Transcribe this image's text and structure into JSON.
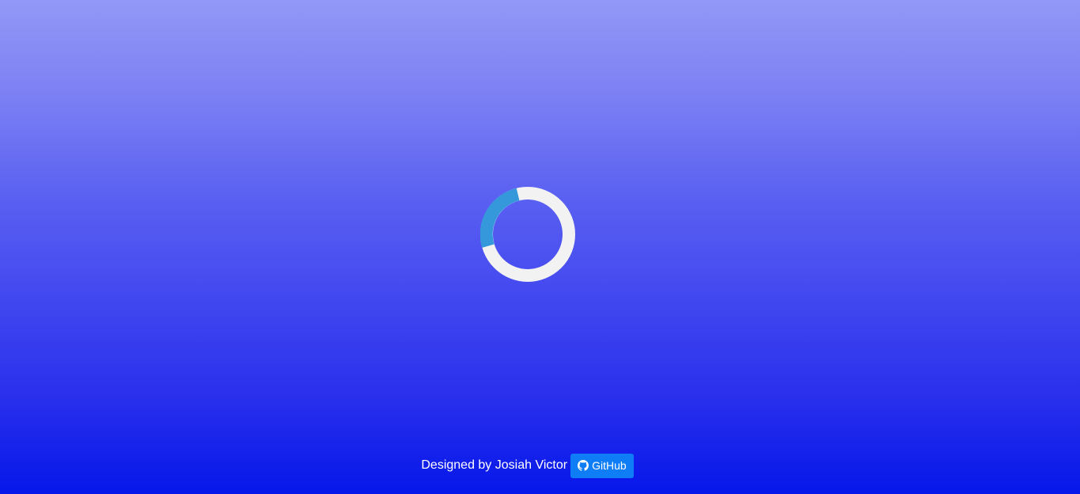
{
  "loader": {
    "icon": "loading-spinner-icon",
    "ring_color": "#f2f2f2",
    "arc_color": "#3498db"
  },
  "footer": {
    "credit_text": "Designed by Josiah Victor",
    "github_label": "GitHub",
    "github_icon": "github-icon",
    "github_button_color": "#0f7df5"
  },
  "background": {
    "top_color": "#9298f6",
    "bottom_color": "#0617ea"
  }
}
